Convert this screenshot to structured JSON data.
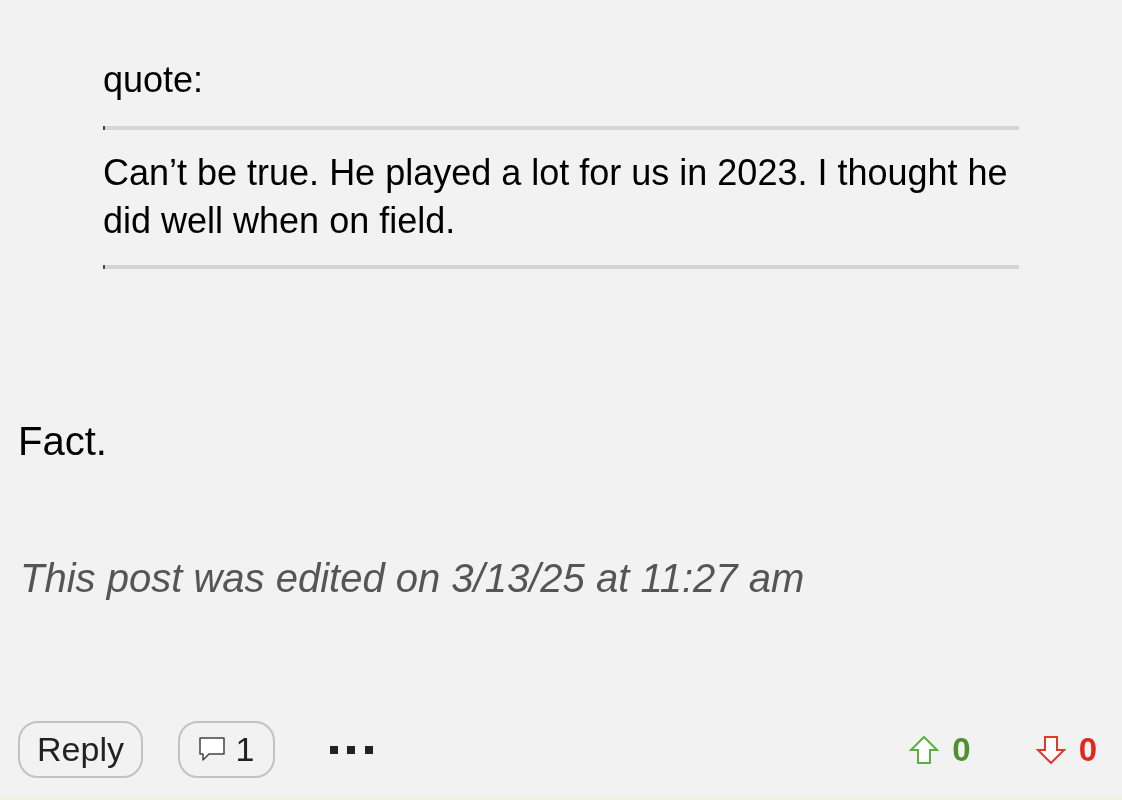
{
  "quote": {
    "label": "quote:",
    "text": "Can’t be true. He played a lot for us in 2023. I thought he did well when on field."
  },
  "body": "Fact.",
  "edit_note": "This post was edited on 3/13/25 at 11:27 am",
  "actions": {
    "reply": "Reply",
    "reply_count": "1"
  },
  "votes": [
    {
      "kind": "up",
      "count": "0"
    },
    {
      "kind": "down",
      "count": "0"
    }
  ]
}
